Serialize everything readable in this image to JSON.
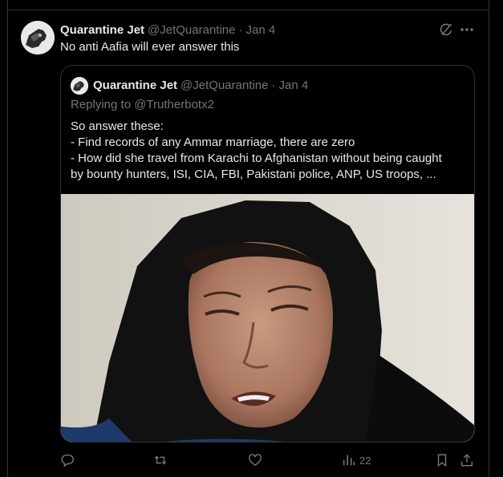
{
  "tweet": {
    "author_name": "Quarantine Jet",
    "author_handle": "@JetQuarantine",
    "separator": "·",
    "date": "Jan 4",
    "text": "No anti Aafia will ever answer this"
  },
  "quoted": {
    "author_name": "Quarantine Jet",
    "author_handle": "@JetQuarantine",
    "separator": "·",
    "date": "Jan 4",
    "replying_prefix": "Replying to",
    "replying_to": "@Trutherbotx2",
    "lines": [
      "So answer these:",
      "- Find records of any Ammar marriage, there are zero",
      "- How did she travel from Karachi to Afghanistan without being caught",
      "by bounty hunters, ISI, CIA, FBI, Pakistani police, ANP, US troops, ..."
    ]
  },
  "actions": {
    "reply_icon": "reply-icon",
    "retweet_icon": "retweet-icon",
    "like_icon": "heart-icon",
    "views_icon": "views-icon",
    "views_count": "22",
    "bookmark_icon": "bookmark-icon",
    "share_icon": "share-icon"
  },
  "colors": {
    "background": "#000000",
    "text": "#e7e9ea",
    "muted": "#71767b",
    "border": "#2f3336"
  }
}
